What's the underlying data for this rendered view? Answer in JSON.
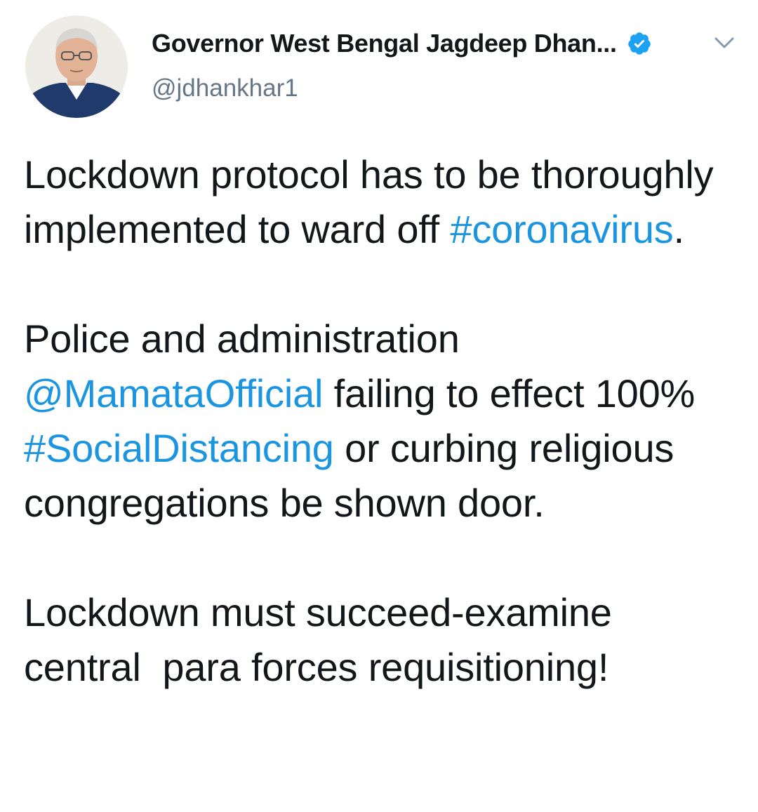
{
  "tweet": {
    "author": {
      "display_name": "Governor West Bengal Jagdeep Dhan...",
      "handle": "@jdhankhar1",
      "verified": true,
      "avatar": "profile-photo"
    },
    "menu_icon": "chevron-down-icon",
    "verified_icon": "verified-badge-icon",
    "paragraphs": [
      [
        {
          "text": "Lockdown protocol has to be thoroughly implemented to ward off ",
          "link": false
        },
        {
          "text": "#coronavirus",
          "link": true
        },
        {
          "text": ".",
          "link": false
        }
      ],
      [
        {
          "text": "Police and administration ",
          "link": false
        },
        {
          "text": "@MamataOfficial",
          "link": true
        },
        {
          "text": " failing to effect 100% ",
          "link": false
        },
        {
          "text": "#SocialDistancing",
          "link": true
        },
        {
          "text": " or curbing religious congregations be shown door.",
          "link": false
        }
      ],
      [
        {
          "text": "Lockdown must succeed-examine central  para forces requisitioning!",
          "link": false
        }
      ]
    ]
  },
  "colors": {
    "text": "#14171a",
    "link": "#1b95e0",
    "secondary": "#657786",
    "verified": "#1da1f2"
  }
}
